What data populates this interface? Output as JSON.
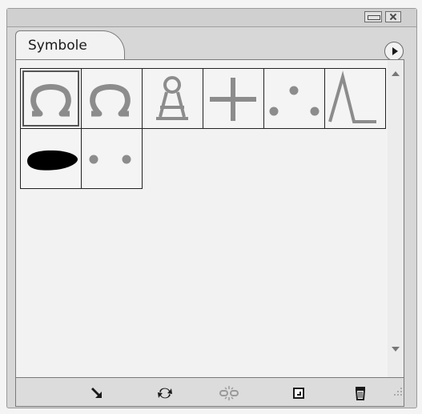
{
  "panel": {
    "tab_label": "Symbole"
  },
  "window_controls": {
    "collapse": "collapse-icon",
    "close": "close-icon"
  },
  "symbols": [
    {
      "name": "omega-outline",
      "selected": true
    },
    {
      "name": "omega-outline-2",
      "selected": false
    },
    {
      "name": "keyhole-figure",
      "selected": false
    },
    {
      "name": "plus-sign",
      "selected": false
    },
    {
      "name": "three-dots",
      "selected": false
    },
    {
      "name": "lambda",
      "selected": false
    },
    {
      "name": "black-blob",
      "selected": false
    },
    {
      "name": "two-dots",
      "selected": false
    }
  ],
  "footer_actions": [
    {
      "icon": "place-symbol-icon"
    },
    {
      "icon": "replace-symbol-icon"
    },
    {
      "icon": "break-link-icon"
    },
    {
      "icon": "new-symbol-icon"
    },
    {
      "icon": "trash-icon"
    }
  ],
  "colors": {
    "symbol_gray": "#8c8c8c",
    "symbol_black": "#000000"
  }
}
